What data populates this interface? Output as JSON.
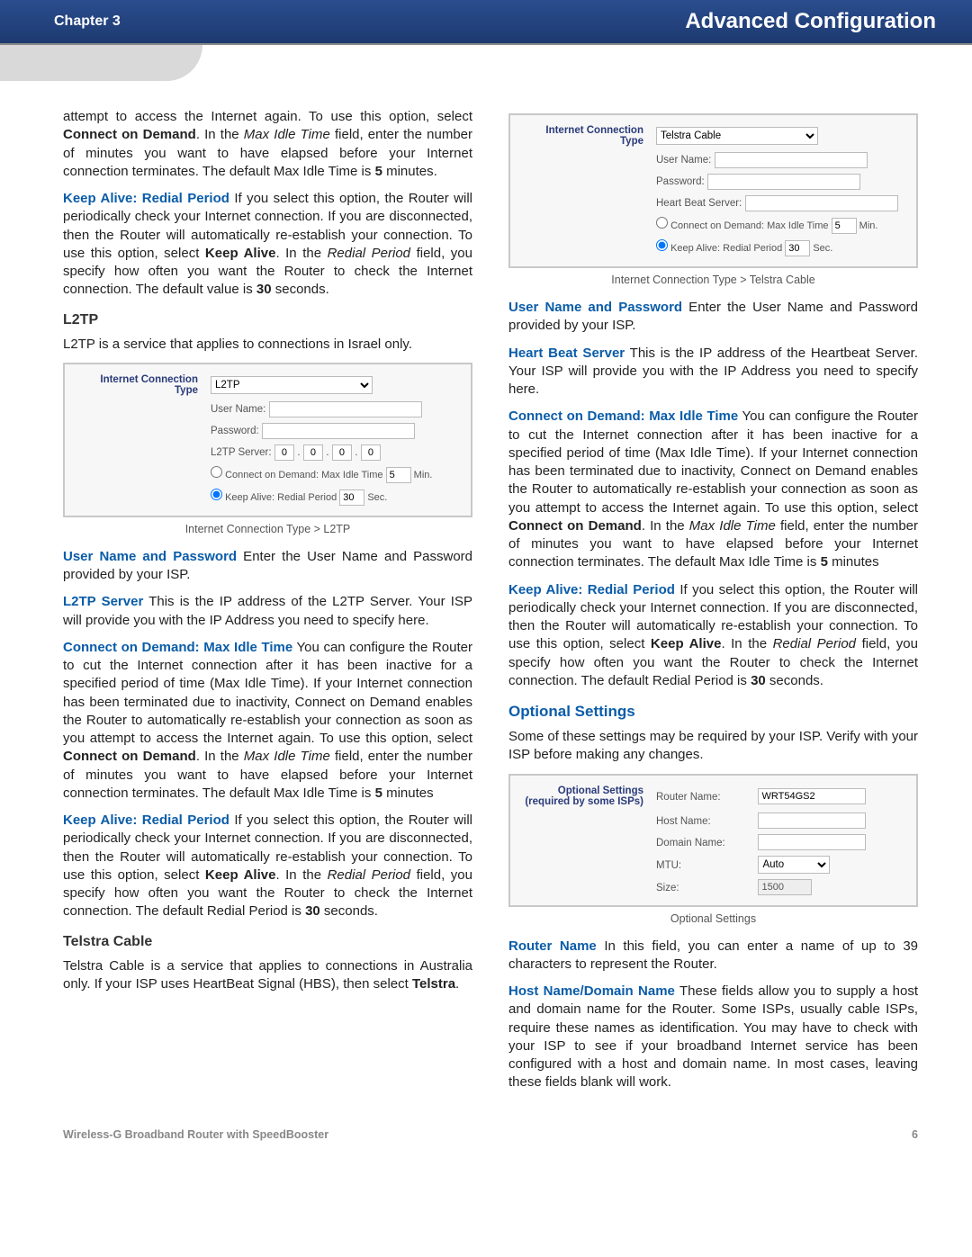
{
  "header": {
    "chapter": "Chapter 3",
    "title": "Advanced Configuration"
  },
  "left": {
    "p1a": "attempt to access the Internet again. To use this option, select ",
    "p1b": "Connect on Demand",
    "p1c": ". In the ",
    "p1d": "Max Idle Time",
    "p1e": " field, enter the number of minutes you want to have elapsed before your Internet connection terminates. The default Max Idle Time is ",
    "p1f": "5",
    "p1g": " minutes.",
    "p2a": "Keep Alive: Redial Period",
    "p2b": "  If you select this option, the Router will periodically check your Internet connection. If you are disconnected, then the Router will automatically re-establish your connection. To use this option, select ",
    "p2c": "Keep Alive",
    "p2d": ". In the ",
    "p2e": "Redial Period",
    "p2f": " field, you specify how often you want the Router to check the Internet connection. The default value is ",
    "p2g": "30",
    "p2h": " seconds.",
    "h_l2tp": "L2TP",
    "p3": "L2TP is a service that applies to connections in Israel only.",
    "cap_l2tp": "Internet Connection Type > L2TP",
    "p4a": "User Name and Password",
    "p4b": "  Enter the User Name and Password provided by your ISP.",
    "p5a": "L2TP Server",
    "p5b": "  This is the IP address of the L2TP Server. Your ISP will provide you with the IP Address you need to specify here.",
    "p6a": "Connect on Demand: Max Idle Time",
    "p6b": "  You can configure the Router to cut the Internet connection after it has been inactive for a specified period of time (Max Idle Time). If your Internet connection has been terminated due to inactivity, Connect on Demand enables the Router to automatically re-establish your connection as soon as you attempt to access the Internet again. To use this option, select ",
    "p6c": "Connect on Demand",
    "p6d": ". In the ",
    "p6e": "Max Idle Time",
    "p6f": " field, enter the number of minutes you want to have elapsed before your Internet connection terminates. The default Max Idle Time is ",
    "p6g": "5",
    "p6h": " minutes",
    "p7a": "Keep Alive: Redial Period",
    "p7b": " If you select this option, the Router will periodically check your Internet connection. If you are disconnected, then the Router will automatically re-establish your connection. To use this option, select ",
    "p7c": "Keep Alive",
    "p7d": ". In the ",
    "p7e": "Redial Period",
    "p7f": " field, you specify how often you want the Router to check the Internet connection. The default Redial Period is ",
    "p7g": "30",
    "p7h": " seconds.",
    "h_telstra": "Telstra Cable",
    "p8a": "Telstra Cable is a service that applies to connections in Australia only. If your ISP uses HeartBeat Signal (HBS), then select ",
    "p8b": "Telstra",
    "p8c": "."
  },
  "right": {
    "cap_telstra": "Internet Connection Type > Telstra Cable",
    "p1a": "User Name and Password",
    "p1b": "  Enter the User Name and Password provided by your ISP.",
    "p2a": "Heart Beat Server",
    "p2b": "  This is the IP address of the Heartbeat Server. Your ISP will provide you with the IP Address you need to specify here.",
    "p3a": "Connect on Demand: Max Idle Time",
    "p3b": "  You can configure the Router to cut the Internet connection after it has been inactive for a specified period of time (Max Idle Time). If your Internet connection has been terminated due to inactivity, Connect on Demand enables the Router to automatically re-establish your connection as soon as you attempt to access the Internet again. To use this option, select ",
    "p3c": "Connect on Demand",
    "p3d": ". In the ",
    "p3e": "Max Idle Time",
    "p3f": " field, enter the number of minutes you want to have elapsed before your Internet connection terminates. The default Max Idle Time is ",
    "p3g": "5",
    "p3h": " minutes",
    "p4a": "Keep Alive: Redial Period",
    "p4b": " If you select this option, the Router will periodically check your Internet connection. If you are disconnected, then the Router will automatically re-establish your connection. To use this option, select ",
    "p4c": "Keep Alive",
    "p4d": ". In the ",
    "p4e": "Redial Period",
    "p4f": " field, you specify how often you want the Router to check the Internet connection. The default Redial Period is ",
    "p4g": "30",
    "p4h": " seconds.",
    "h_opt": "Optional Settings",
    "p5": "Some of these settings may be required by your ISP. Verify with your ISP before making any changes.",
    "cap_opt": "Optional Settings",
    "p6a": "Router Name",
    "p6b": "  In this field, you can enter a name of up to 39 characters to represent the Router.",
    "p7a": "Host Name/Domain Name",
    "p7b": "  These fields allow you to supply a host and domain name for the Router. Some ISPs, usually cable ISPs, require these names as identification. You may have to check with your ISP to see if your broadband Internet service has been configured with a host and domain name. In most cases, leaving these fields blank will work."
  },
  "shots": {
    "ict_label": "Internet Connection Type",
    "l2tp_type": "L2TP",
    "telstra_type": "Telstra Cable",
    "user": "User Name:",
    "pass": "Password:",
    "l2tp_server": "L2TP Server:",
    "hbs": "Heart Beat Server:",
    "cod": "Connect on Demand: Max Idle Time",
    "cod_val": "5",
    "min": "Min.",
    "ka": "Keep Alive: Redial Period",
    "ka_val": "30",
    "sec": "Sec.",
    "oct": "0",
    "opt_label1": "Optional Settings",
    "opt_label2": "(required by some ISPs)",
    "rname": "Router Name:",
    "rname_val": "WRT54GS2",
    "hname": "Host Name:",
    "dname": "Domain Name:",
    "mtu": "MTU:",
    "mtu_val": "Auto",
    "size": "Size:",
    "size_val": "1500"
  },
  "footer": {
    "left": "Wireless-G Broadband Router with SpeedBooster",
    "right": "6"
  }
}
